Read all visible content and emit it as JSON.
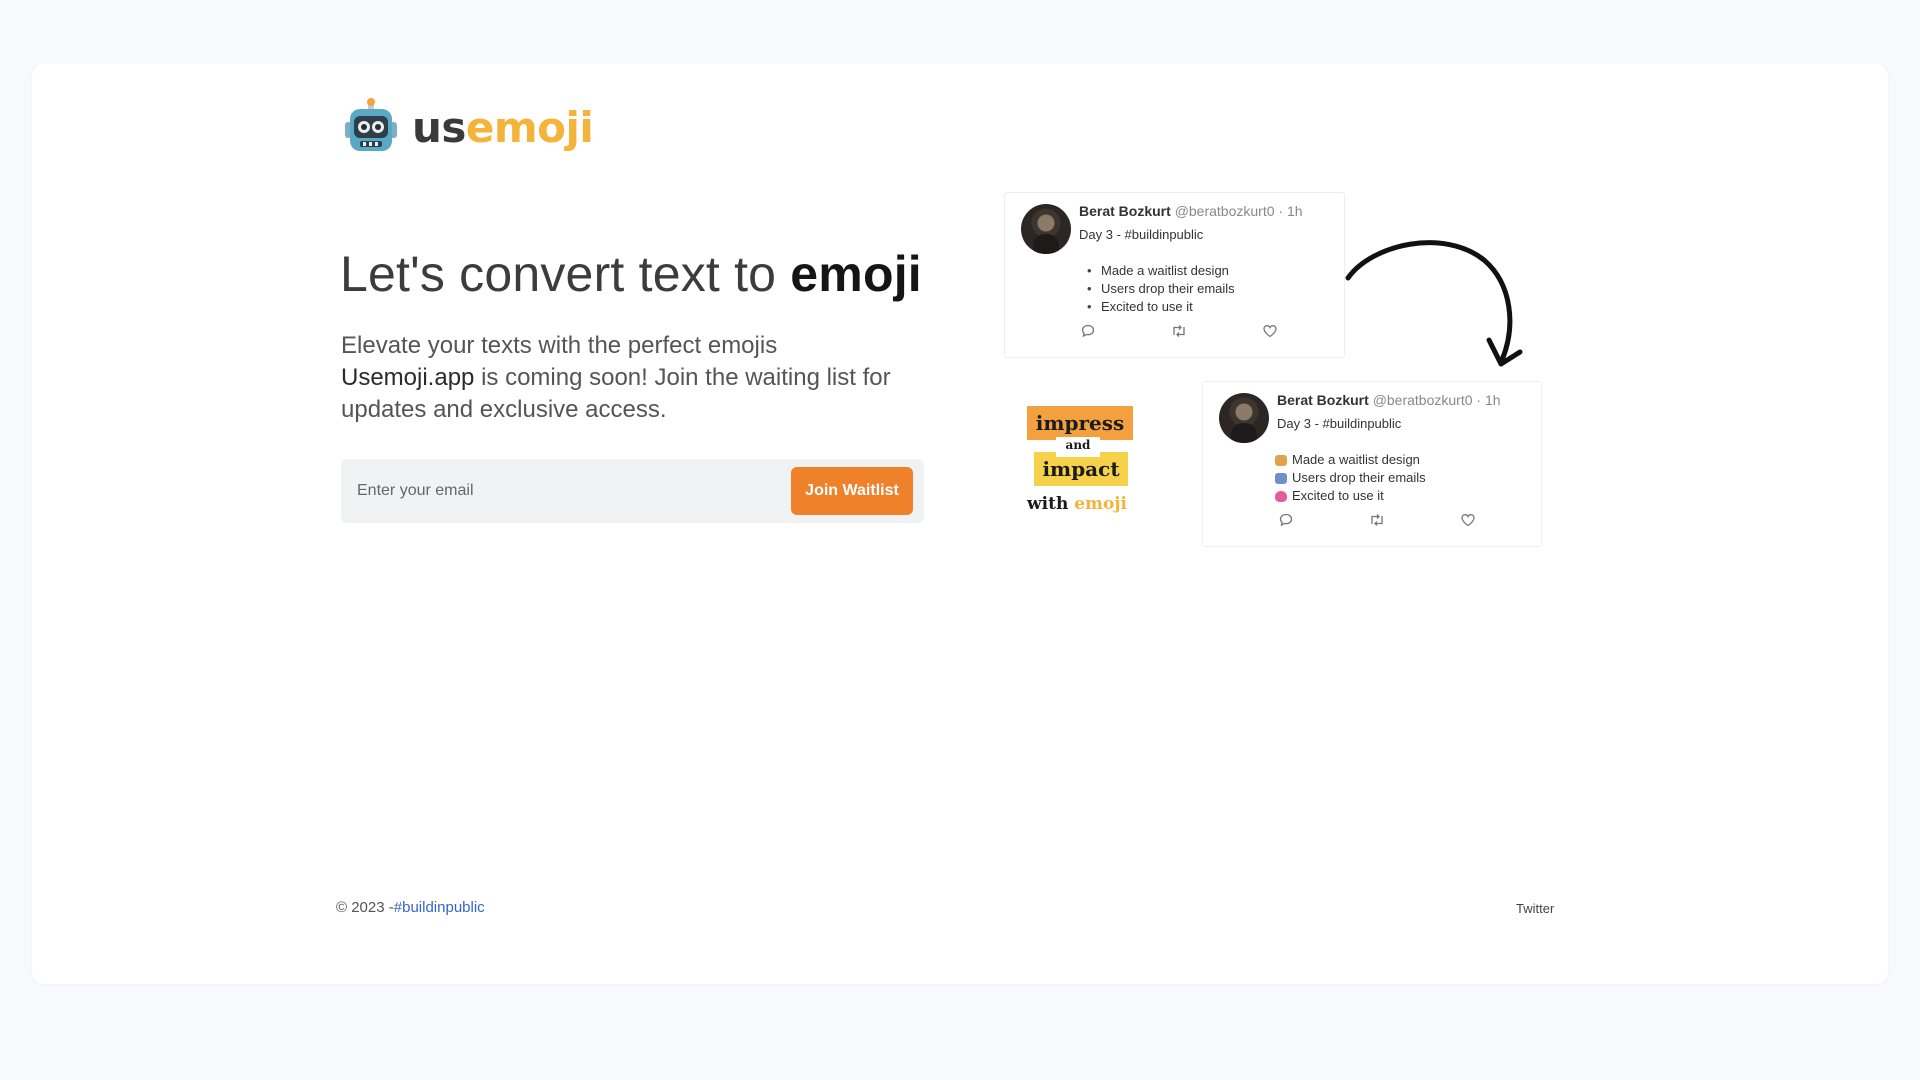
{
  "logo": {
    "prefix": "us",
    "accent": "emoji",
    "icon": "robot-icon"
  },
  "hero": {
    "headline_thin": "Let's convert text to ",
    "headline_bold": "emoji",
    "line1": "Elevate your texts with the perfect emojis",
    "brand": "Usemoji.app",
    "line2_rest": " is coming soon! Join the waiting list for updates and exclusive access."
  },
  "form": {
    "email_placeholder": "Enter your email",
    "email_value": "",
    "button_label": "Join Waitlist"
  },
  "tweets": [
    {
      "name": "Berat Bozkurt",
      "handle": "@beratbozkurt0",
      "time": " · 1h",
      "subtitle": "Day 3 - #buildinpublic",
      "items": [
        "Made a waitlist design",
        "Users drop their emails",
        "Excited to use it"
      ]
    },
    {
      "name": "Berat Bozkurt",
      "handle": "@beratbozkurt0",
      "time": " · 1h",
      "subtitle": "Day 3 - #buildinpublic",
      "items": [
        "Made a waitlist design",
        "Users drop their emails",
        "Excited to use it"
      ]
    }
  ],
  "graphic": {
    "word1": "impress",
    "word2": "and",
    "word3": "impact",
    "with": "with ",
    "accent": "emoji"
  },
  "footer": {
    "copyright": "© 2023 -",
    "hashtag": "#buildinpublic",
    "twitter": "Twitter"
  },
  "colors": {
    "accent": "#f0812b",
    "logo_accent": "#f4b43a",
    "link": "#3366cc"
  }
}
